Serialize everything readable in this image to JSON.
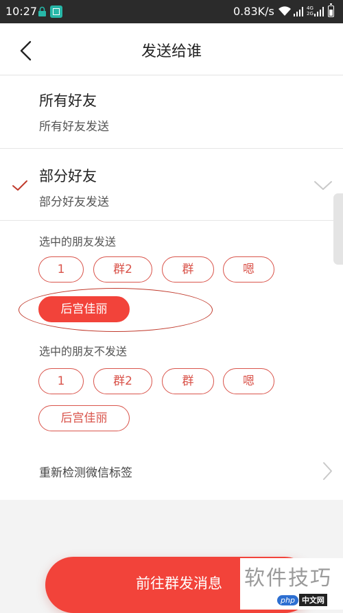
{
  "status_bar": {
    "time": "10:27",
    "network_speed": "0.83K/s",
    "network_type_top": "4G",
    "network_type_bottom": "2G"
  },
  "nav": {
    "title": "发送给谁"
  },
  "options": {
    "all": {
      "title": "所有好友",
      "subtitle": "所有好友发送"
    },
    "some": {
      "title": "部分好友",
      "subtitle": "部分好友发送",
      "checked": true
    }
  },
  "send_to": {
    "label": "选中的朋友发送",
    "tags": [
      {
        "label": "1",
        "selected": false
      },
      {
        "label": "群2",
        "selected": false
      },
      {
        "label": "群",
        "selected": false
      },
      {
        "label": "嗯",
        "selected": false
      },
      {
        "label": "后宫佳丽",
        "selected": true
      }
    ]
  },
  "exclude": {
    "label": "选中的朋友不发送",
    "tags": [
      {
        "label": "1",
        "selected": false
      },
      {
        "label": "群2",
        "selected": false
      },
      {
        "label": "群",
        "selected": false
      },
      {
        "label": "嗯",
        "selected": false
      },
      {
        "label": "后宫佳丽",
        "selected": false
      }
    ]
  },
  "relabel": {
    "text": "重新检测微信标签"
  },
  "send_button": {
    "label": "前往群发消息"
  },
  "watermark": {
    "main": "软件技巧",
    "logo_php": "php",
    "logo_cn": "中文网"
  },
  "colors": {
    "accent": "#f2433a",
    "chip_border": "#d9534a",
    "status_bar": "#2b2b2b",
    "check": "#c0392b"
  }
}
